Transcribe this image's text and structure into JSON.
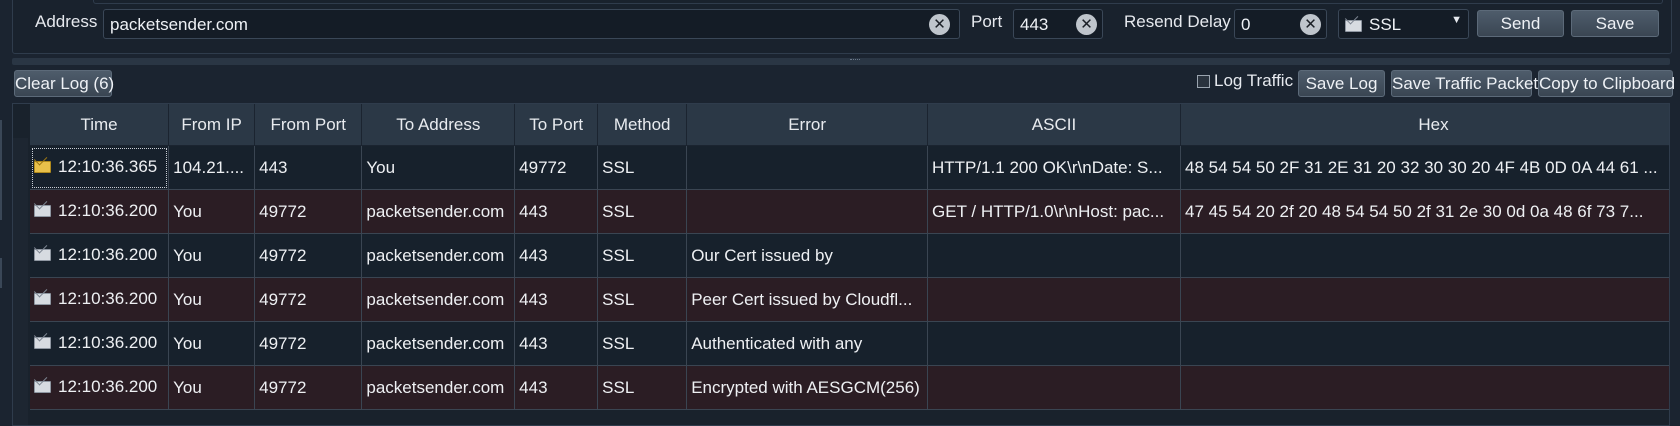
{
  "connection": {
    "address_label": "Address",
    "address_value": "packetsender.com",
    "port_label": "Port",
    "port_value": "443",
    "resend_label": "Resend Delay",
    "resend_value": "0",
    "protocol_value": "SSL",
    "send_label": "Send",
    "save_label": "Save"
  },
  "log_toolbar": {
    "clear_log_label": "Clear Log (6)",
    "log_traffic_label": "Log Traffic",
    "log_traffic_checked": false,
    "save_log_label": "Save Log",
    "save_traffic_label": "Save Traffic Packet",
    "copy_label": "Copy to Clipboard"
  },
  "table": {
    "columns": [
      "Time",
      "From IP",
      "From Port",
      "To Address",
      "To Port",
      "Method",
      "Error",
      "ASCII",
      "Hex"
    ],
    "rows": [
      {
        "icon": "received-mail-icon",
        "time": "12:10:36.365",
        "from_ip": "104.21....",
        "from_port": "443",
        "to_address": "You",
        "to_port": "49772",
        "method": "SSL",
        "error": "",
        "ascii": "HTTP/1.1 200 OK\\r\\nDate: S...",
        "hex": "48 54 54 50 2F 31 2E 31 20 32 30 30 20 4F 4B 0D 0A 44 61 ..."
      },
      {
        "icon": "sent-mail-icon",
        "time": "12:10:36.200",
        "from_ip": "You",
        "from_port": "49772",
        "to_address": "packetsender.com",
        "to_port": "443",
        "method": "SSL",
        "error": "",
        "ascii": "GET / HTTP/1.0\\r\\nHost: pac...",
        "hex": "47 45 54 20 2f 20 48 54 54 50 2f 31 2e 30 0d 0a 48 6f 73 7..."
      },
      {
        "icon": "sent-mail-icon",
        "time": "12:10:36.200",
        "from_ip": "You",
        "from_port": "49772",
        "to_address": "packetsender.com",
        "to_port": "443",
        "method": "SSL",
        "error": "Our Cert issued by",
        "ascii": "",
        "hex": ""
      },
      {
        "icon": "sent-mail-icon",
        "time": "12:10:36.200",
        "from_ip": "You",
        "from_port": "49772",
        "to_address": "packetsender.com",
        "to_port": "443",
        "method": "SSL",
        "error": "Peer Cert issued by Cloudfl...",
        "ascii": "",
        "hex": ""
      },
      {
        "icon": "sent-mail-icon",
        "time": "12:10:36.200",
        "from_ip": "You",
        "from_port": "49772",
        "to_address": "packetsender.com",
        "to_port": "443",
        "method": "SSL",
        "error": "Authenticated with any",
        "ascii": "",
        "hex": ""
      },
      {
        "icon": "sent-mail-icon",
        "time": "12:10:36.200",
        "from_ip": "You",
        "from_port": "49772",
        "to_address": "packetsender.com",
        "to_port": "443",
        "method": "SSL",
        "error": "Encrypted with AESGCM(256)",
        "ascii": "",
        "hex": ""
      }
    ]
  },
  "colors": {
    "background": "#1b2430",
    "header": "#2b3846",
    "row_odd": "#17212c",
    "row_even": "#2b1d24",
    "button": "#44505e",
    "received_icon": "#e8c04a"
  }
}
